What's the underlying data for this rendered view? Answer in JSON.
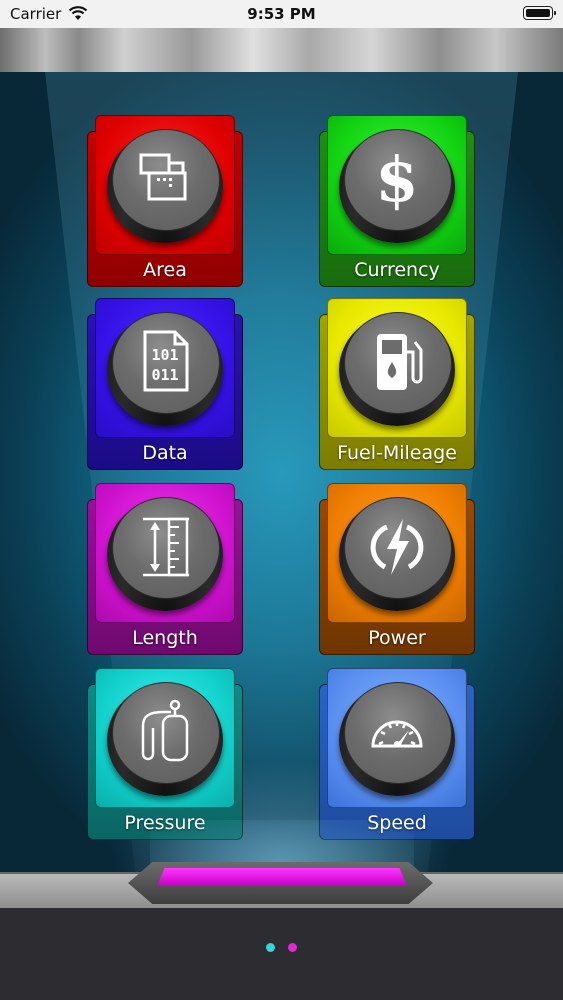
{
  "status_bar": {
    "carrier": "Carrier",
    "time": "9:53 PM"
  },
  "tiles": [
    {
      "label": "Area",
      "icon": "area-icon",
      "color": "#e00000"
    },
    {
      "label": "Currency",
      "icon": "dollar-icon",
      "color": "#12d212"
    },
    {
      "label": "Data",
      "icon": "binary-file-icon",
      "color": "#3511e6"
    },
    {
      "label": "Fuel-Mileage",
      "icon": "fuel-pump-icon",
      "color": "#e7e700"
    },
    {
      "label": "Length",
      "icon": "ruler-icon",
      "color": "#cf12cf"
    },
    {
      "label": "Power",
      "icon": "lightning-icon",
      "color": "#ee7d00"
    },
    {
      "label": "Pressure",
      "icon": "gas-cylinder-icon",
      "color": "#12d0cc"
    },
    {
      "label": "Speed",
      "icon": "speedometer-icon",
      "color": "#5a8ff0"
    }
  ],
  "page_indicator": {
    "dots": [
      {
        "state": "active",
        "color": "#35d6d6"
      },
      {
        "state": "inactive",
        "color": "#e02ad8"
      }
    ]
  },
  "accent_color": "#ff35ff"
}
